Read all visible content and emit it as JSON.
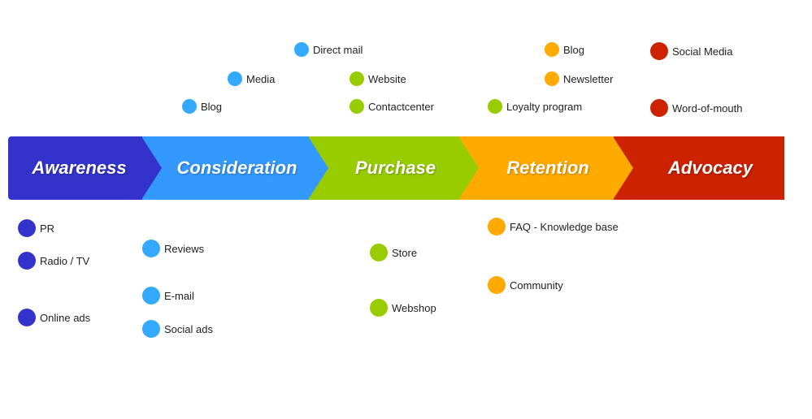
{
  "funnel": {
    "segments": [
      {
        "id": "awareness",
        "label": "Awareness",
        "color": "#3333cc"
      },
      {
        "id": "consideration",
        "label": "Consideration",
        "color": "#3399ff"
      },
      {
        "id": "purchase",
        "label": "Purchase",
        "color": "#99cc00"
      },
      {
        "id": "retention",
        "label": "Retention",
        "color": "#ffaa00"
      },
      {
        "id": "advocacy",
        "label": "Advocacy",
        "color": "#cc2200"
      }
    ]
  },
  "top_labels": [
    {
      "id": "direct-mail",
      "text": "Direct mail",
      "dot_color": "blue-light"
    },
    {
      "id": "media",
      "text": "Media",
      "dot_color": "blue-light"
    },
    {
      "id": "blog-top",
      "text": "Blog",
      "dot_color": "blue-light"
    },
    {
      "id": "website",
      "text": "Website",
      "dot_color": "green"
    },
    {
      "id": "contactcenter",
      "text": "Contactcenter",
      "dot_color": "green"
    },
    {
      "id": "loyalty",
      "text": "Loyalty program",
      "dot_color": "green"
    },
    {
      "id": "blog-right",
      "text": "Blog",
      "dot_color": "yellow"
    },
    {
      "id": "newsletter",
      "text": "Newsletter",
      "dot_color": "yellow"
    },
    {
      "id": "social-media",
      "text": "Social Media",
      "dot_color": "red"
    },
    {
      "id": "word-of-mouth",
      "text": "Word-of-mouth",
      "dot_color": "red"
    }
  ],
  "bottom_labels": [
    {
      "id": "pr",
      "text": "PR",
      "dot_color": "blue-dark"
    },
    {
      "id": "radio-tv",
      "text": "Radio / TV",
      "dot_color": "blue-dark"
    },
    {
      "id": "online-ads",
      "text": "Online ads",
      "dot_color": "blue-dark"
    },
    {
      "id": "reviews",
      "text": "Reviews",
      "dot_color": "blue-light"
    },
    {
      "id": "email",
      "text": "E-mail",
      "dot_color": "blue-light"
    },
    {
      "id": "social-ads",
      "text": "Social ads",
      "dot_color": "blue-light"
    },
    {
      "id": "store",
      "text": "Store",
      "dot_color": "green"
    },
    {
      "id": "webshop",
      "text": "Webshop",
      "dot_color": "green"
    },
    {
      "id": "faq",
      "text": "FAQ - Knowledge base",
      "dot_color": "yellow"
    },
    {
      "id": "community",
      "text": "Community",
      "dot_color": "yellow"
    }
  ],
  "dot_sizes": {
    "large": 22,
    "medium": 18
  }
}
